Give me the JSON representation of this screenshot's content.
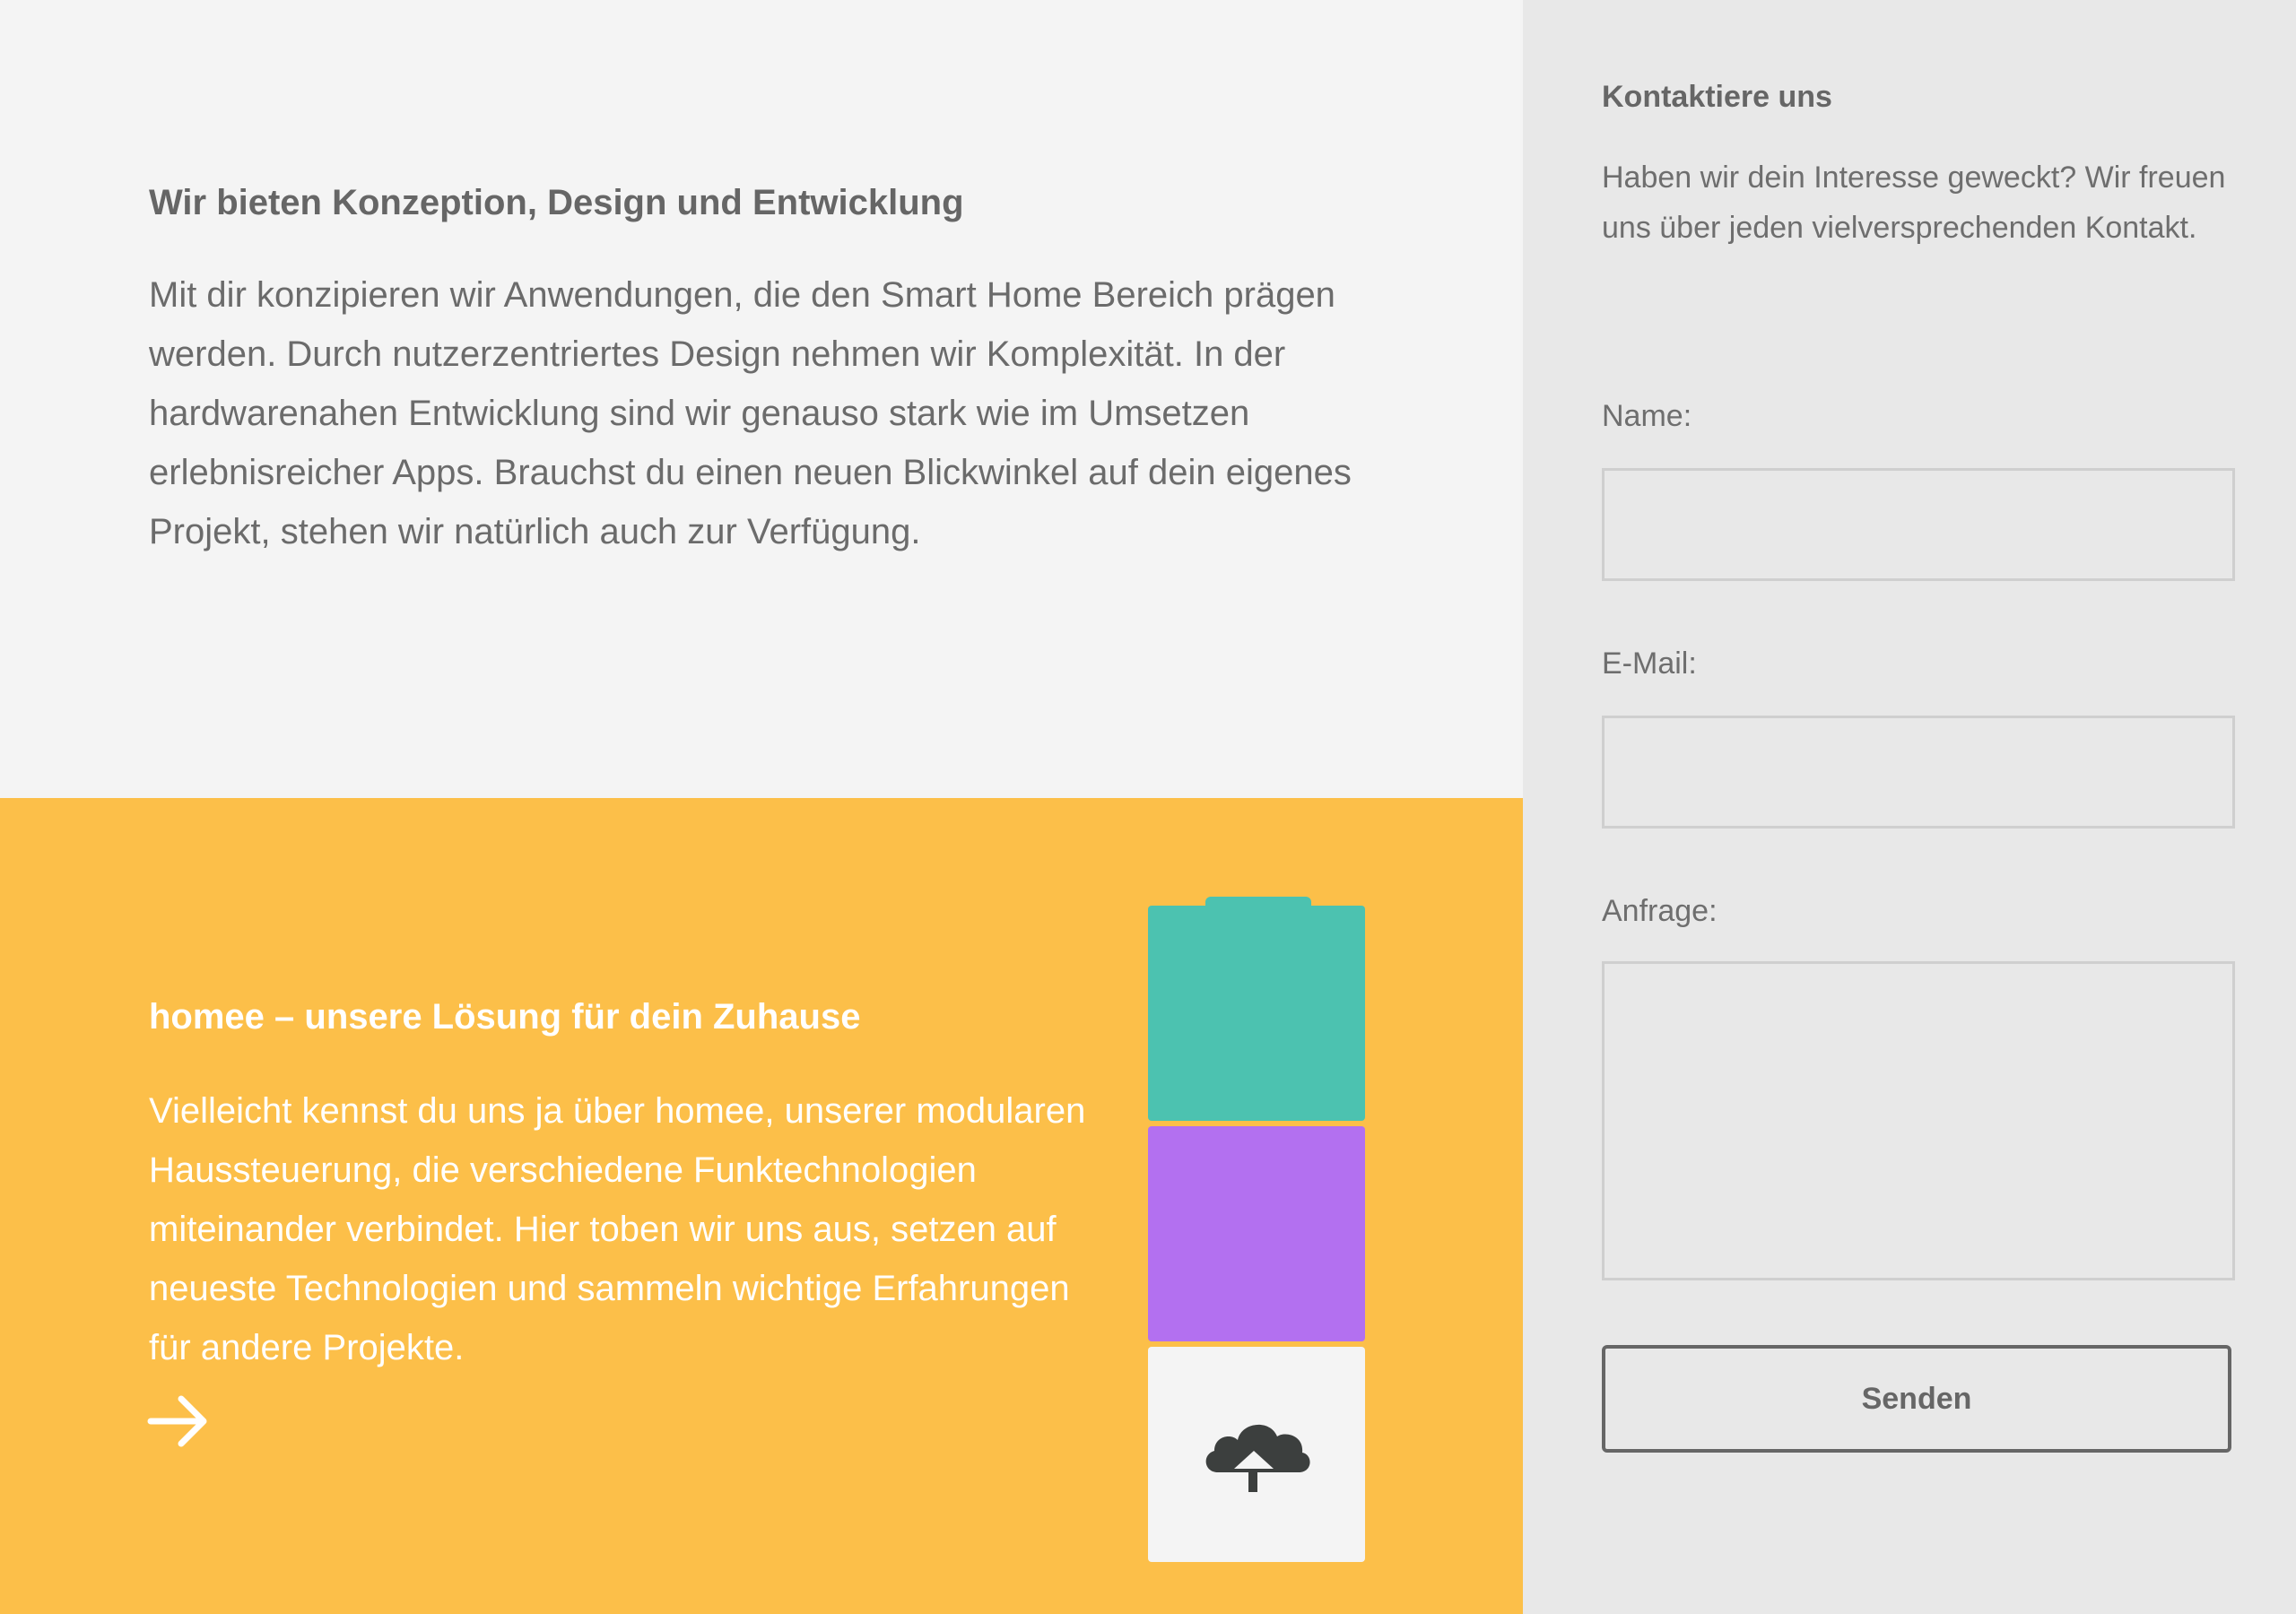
{
  "intro": {
    "heading": "Wir bieten Konzeption, Design und Entwicklung",
    "text": "Mit dir konzipieren wir Anwendungen, die den Smart Home Bereich prägen werden. Durch nutzerzentriertes Design nehmen wir Komplexität. In der hardwarenahen Entwicklung sind wir genauso stark wie im Umsetzen erlebnisreicher Apps. Brauchst du einen neuen Blickwinkel auf dein eigenes Projekt, stehen wir natürlich auch zur Verfügung."
  },
  "homee": {
    "heading": "homee – unsere Lösung für dein Zuhause",
    "text": "Vielleicht kennst du uns ja über homee, unserer modularen Haussteuerung, die verschiedene Funktechnologien miteinander verbindet. Hier toben wir uns aus, setzen auf neueste Technologien und sammeln wichtige Erfahrungen für andere Projekte.",
    "link_icon": "arrow-right-icon",
    "cube_icon": "cloud-home-icon"
  },
  "contact": {
    "title": "Kontaktiere uns",
    "description": "Haben wir dein Interesse geweckt? Wir freuen uns über jeden vielversprechenden Kontakt.",
    "name_label": "Name:",
    "email_label": "E-Mail:",
    "request_label": "Anfrage:",
    "name_value": "",
    "email_value": "",
    "request_value": "",
    "submit_label": "Senden"
  },
  "colors": {
    "page_bg": "#f4f4f4",
    "sidebar_bg": "#e8e8e8",
    "accent_yellow": "#fcbf49",
    "cube_teal": "#4cc2b0",
    "cube_purple": "#b370f0",
    "cube_white": "#f4f4f4",
    "icon_dark": "#3c3f3e"
  }
}
